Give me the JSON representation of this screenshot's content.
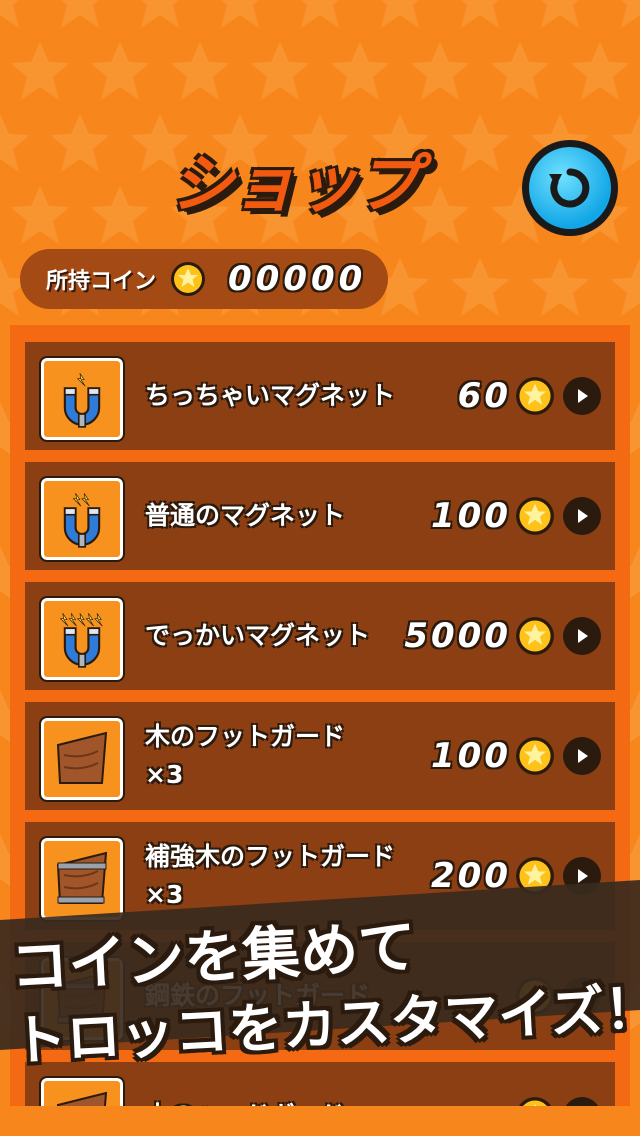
{
  "header": {
    "title": "ショップ",
    "back_icon": "refresh-back-icon"
  },
  "coins": {
    "label": "所持コイン",
    "amount": "00000",
    "icon": "star-coin-icon"
  },
  "items": [
    {
      "name_line1": "ちっちゃいマグネット",
      "name_line2": "",
      "price": "60",
      "icon": "small-magnet-icon"
    },
    {
      "name_line1": "普通のマグネット",
      "name_line2": "",
      "price": "100",
      "icon": "magnet-icon"
    },
    {
      "name_line1": "でっかいマグネット",
      "name_line2": "",
      "price": "5000",
      "icon": "big-magnet-icon"
    },
    {
      "name_line1": "木のフットガード",
      "name_line2": "×3",
      "price": "100",
      "icon": "wood-foot-guard-icon"
    },
    {
      "name_line1": "補強木のフットガード",
      "name_line2": "×3",
      "price": "200",
      "icon": "reinforced-wood-foot-guard-icon"
    },
    {
      "name_line1": "鋼鉄のフットガード",
      "name_line2": "",
      "price": "",
      "icon": "steel-foot-guard-icon"
    },
    {
      "name_line1": "木のヘッドガード",
      "name_line2": "",
      "price": "",
      "icon": "wood-head-guard-icon"
    }
  ],
  "banner": {
    "line1": "コインを集めて",
    "line2": "トロッコをカスタマイズ！"
  },
  "colors": {
    "background": "#f7861c",
    "row": "#8c3f12",
    "accent_blue": "#12a6e6",
    "coin_gold": "#ffc21a"
  }
}
